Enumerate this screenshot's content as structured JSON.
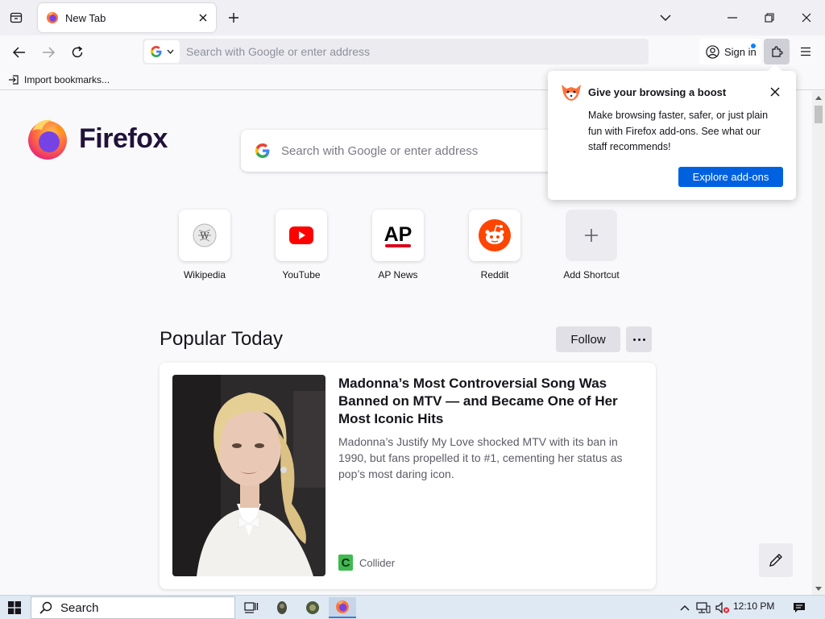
{
  "browser": {
    "tab": {
      "title": "New Tab"
    },
    "urlbar": {
      "placeholder": "Search with Google or enter address"
    },
    "signin_label": "Sign in",
    "bookmarks": {
      "import_label": "Import bookmarks..."
    }
  },
  "newtab": {
    "logo_text": "Firefox",
    "search_placeholder": "Search with Google or enter address",
    "shortcuts": [
      {
        "label": "Wikipedia",
        "icon": "wikipedia-icon"
      },
      {
        "label": "YouTube",
        "icon": "youtube-icon"
      },
      {
        "label": "AP News",
        "icon": "ap-news-icon"
      },
      {
        "label": "Reddit",
        "icon": "reddit-icon"
      },
      {
        "label": "Add Shortcut",
        "icon": "plus-icon"
      }
    ],
    "section": {
      "title": "Popular Today",
      "follow_label": "Follow"
    },
    "story": {
      "headline": "Madonna’s Most Controversial Song Was Banned on MTV — and Became One of Her Most Iconic Hits",
      "excerpt": "Madonna’s Justify My Love shocked MTV with its ban in 1990, but fans propelled it to #1, cementing her status as pop’s most daring icon.",
      "source": "Collider",
      "source_initial": "C"
    }
  },
  "popup": {
    "title": "Give your browsing a boost",
    "body": "Make browsing faster, safer, or just plain fun with Firefox add-ons. See what our staff recommends!",
    "cta_label": "Explore add-ons"
  },
  "taskbar": {
    "search_label": "Search",
    "clock": "12:10 PM"
  },
  "colors": {
    "accent": "#0061e0",
    "youtube": "#ff0000",
    "reddit": "#ff4500",
    "ap": "#d6001c",
    "source_icon": "#3fb950"
  }
}
